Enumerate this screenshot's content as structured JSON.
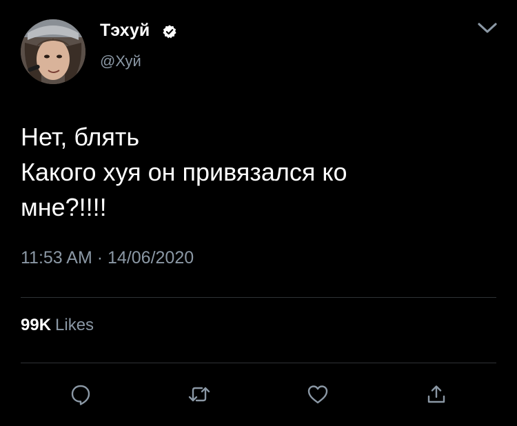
{
  "tweet": {
    "author": {
      "name": "Тэхуй",
      "handle": "@Хуй",
      "verified": true
    },
    "text": "Нет, блять\nКакого хуя он привязался ко\nмне?!!!!",
    "time": "11:53 AM",
    "separator": "·",
    "date": "14/06/2020",
    "likes": {
      "count": "99K",
      "label": "Likes"
    }
  },
  "actions": [
    {
      "icon": "reply-icon"
    },
    {
      "icon": "retweet-icon"
    },
    {
      "icon": "like-icon"
    },
    {
      "icon": "share-icon"
    }
  ],
  "colors": {
    "background": "#000000",
    "primary_text": "#ffffff",
    "secondary_text": "#8b98a5",
    "divider": "#2f3336",
    "icon": "#8b98a5"
  }
}
